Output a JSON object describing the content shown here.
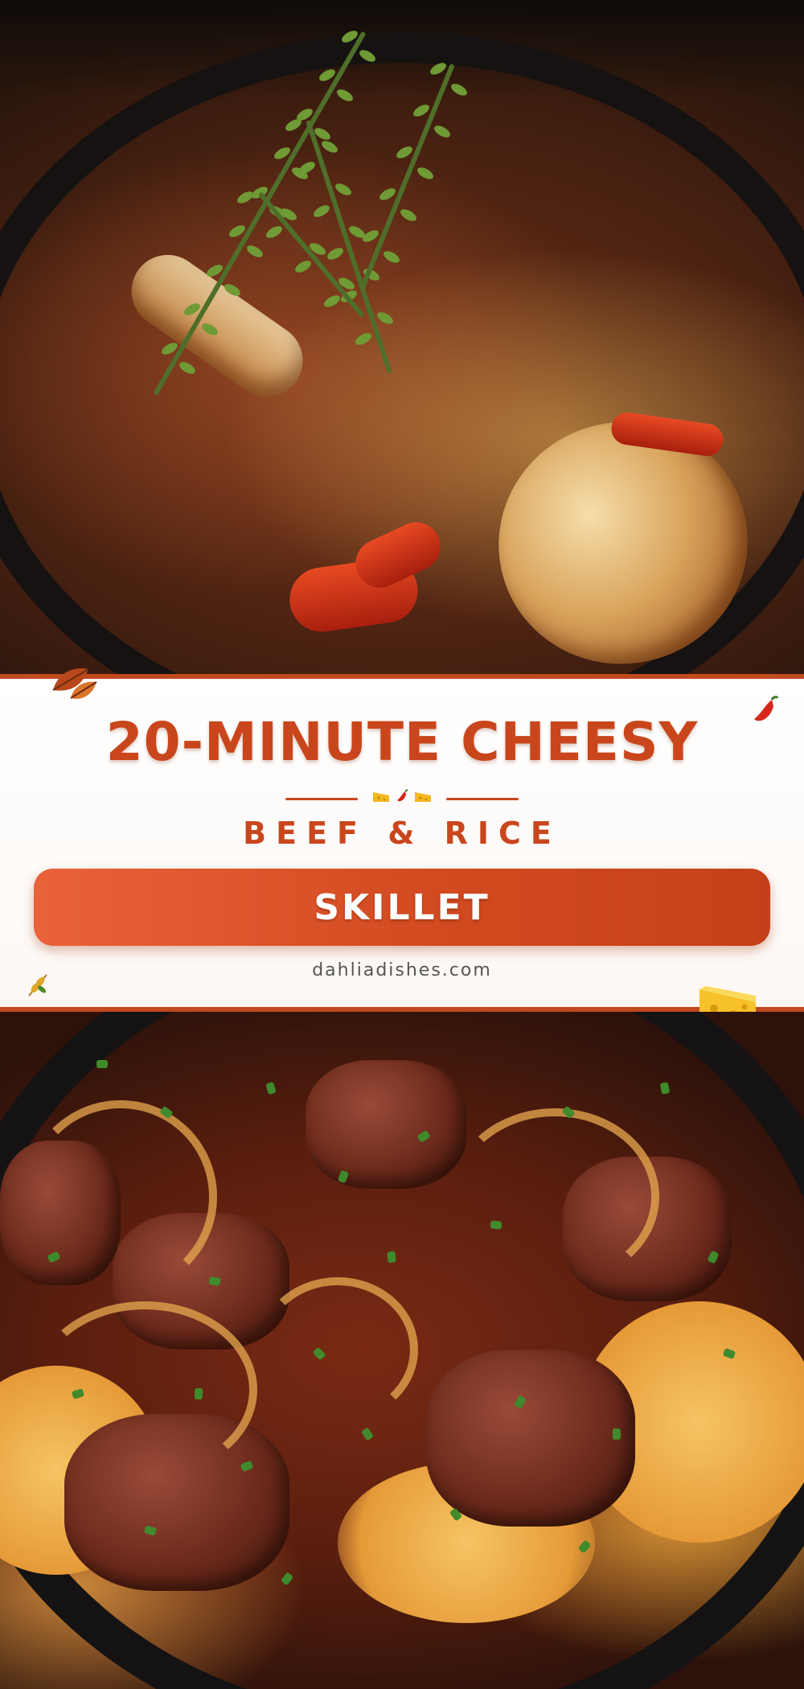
{
  "banner": {
    "title": "20-MINUTE CHEESY",
    "subtitle": "BEEF & RICE",
    "pill_label": "SKILLET",
    "website": "dahliadishes.com"
  },
  "images": {
    "top": "skillet of ground beef, rice, onions, red peppers and fresh thyme",
    "bottom": "close-up of glazed beef chunks with caramelized onions over orange rice"
  },
  "colors": {
    "accent": "#c9461c",
    "pill_start": "#e9623a",
    "pill_end": "#c5401a",
    "banner_bg": "#ffffff"
  },
  "icons": [
    "autumn-leaf-icon",
    "chili-pepper-icon",
    "cheese-icon",
    "wheat-icon"
  ]
}
